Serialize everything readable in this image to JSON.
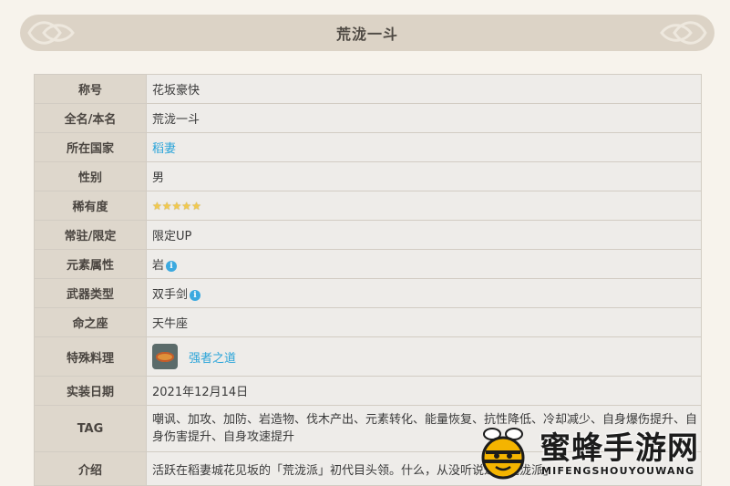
{
  "page": {
    "title": "荒泷一斗"
  },
  "rows": [
    {
      "label": "称号",
      "value": "花坂豪快"
    },
    {
      "label": "全名/本名",
      "value": "荒泷一斗"
    },
    {
      "label": "所在国家",
      "value": "稻妻"
    },
    {
      "label": "性别",
      "value": "男"
    },
    {
      "label": "稀有度",
      "stars": 5
    },
    {
      "label": "常驻/限定",
      "value": "限定UP"
    },
    {
      "label": "元素属性",
      "value": "岩"
    },
    {
      "label": "武器类型",
      "value": "双手剑"
    },
    {
      "label": "命之座",
      "value": "天牛座"
    },
    {
      "label": "特殊料理",
      "value": "强者之道"
    },
    {
      "label": "实装日期",
      "value": "2021年12月14日"
    },
    {
      "label": "TAG",
      "value": "嘲讽、加攻、加防、岩造物、伐木产出、元素转化、能量恢复、抗性降低、冷却减少、自身爆伤提升、自身伤害提升、自身攻速提升"
    },
    {
      "label": "介绍",
      "value": "活跃在稻妻城花见坂的「荒泷派」初代目头领。什么，从没听说过「荒泷派」"
    }
  ],
  "colors": {
    "link": "#2aa4d9",
    "star": "#f2c94c",
    "info": "#3ba9df"
  },
  "watermark": {
    "name": "蜜蜂手游网",
    "pinyin": "MIFENGSHOUYOUWANG"
  }
}
